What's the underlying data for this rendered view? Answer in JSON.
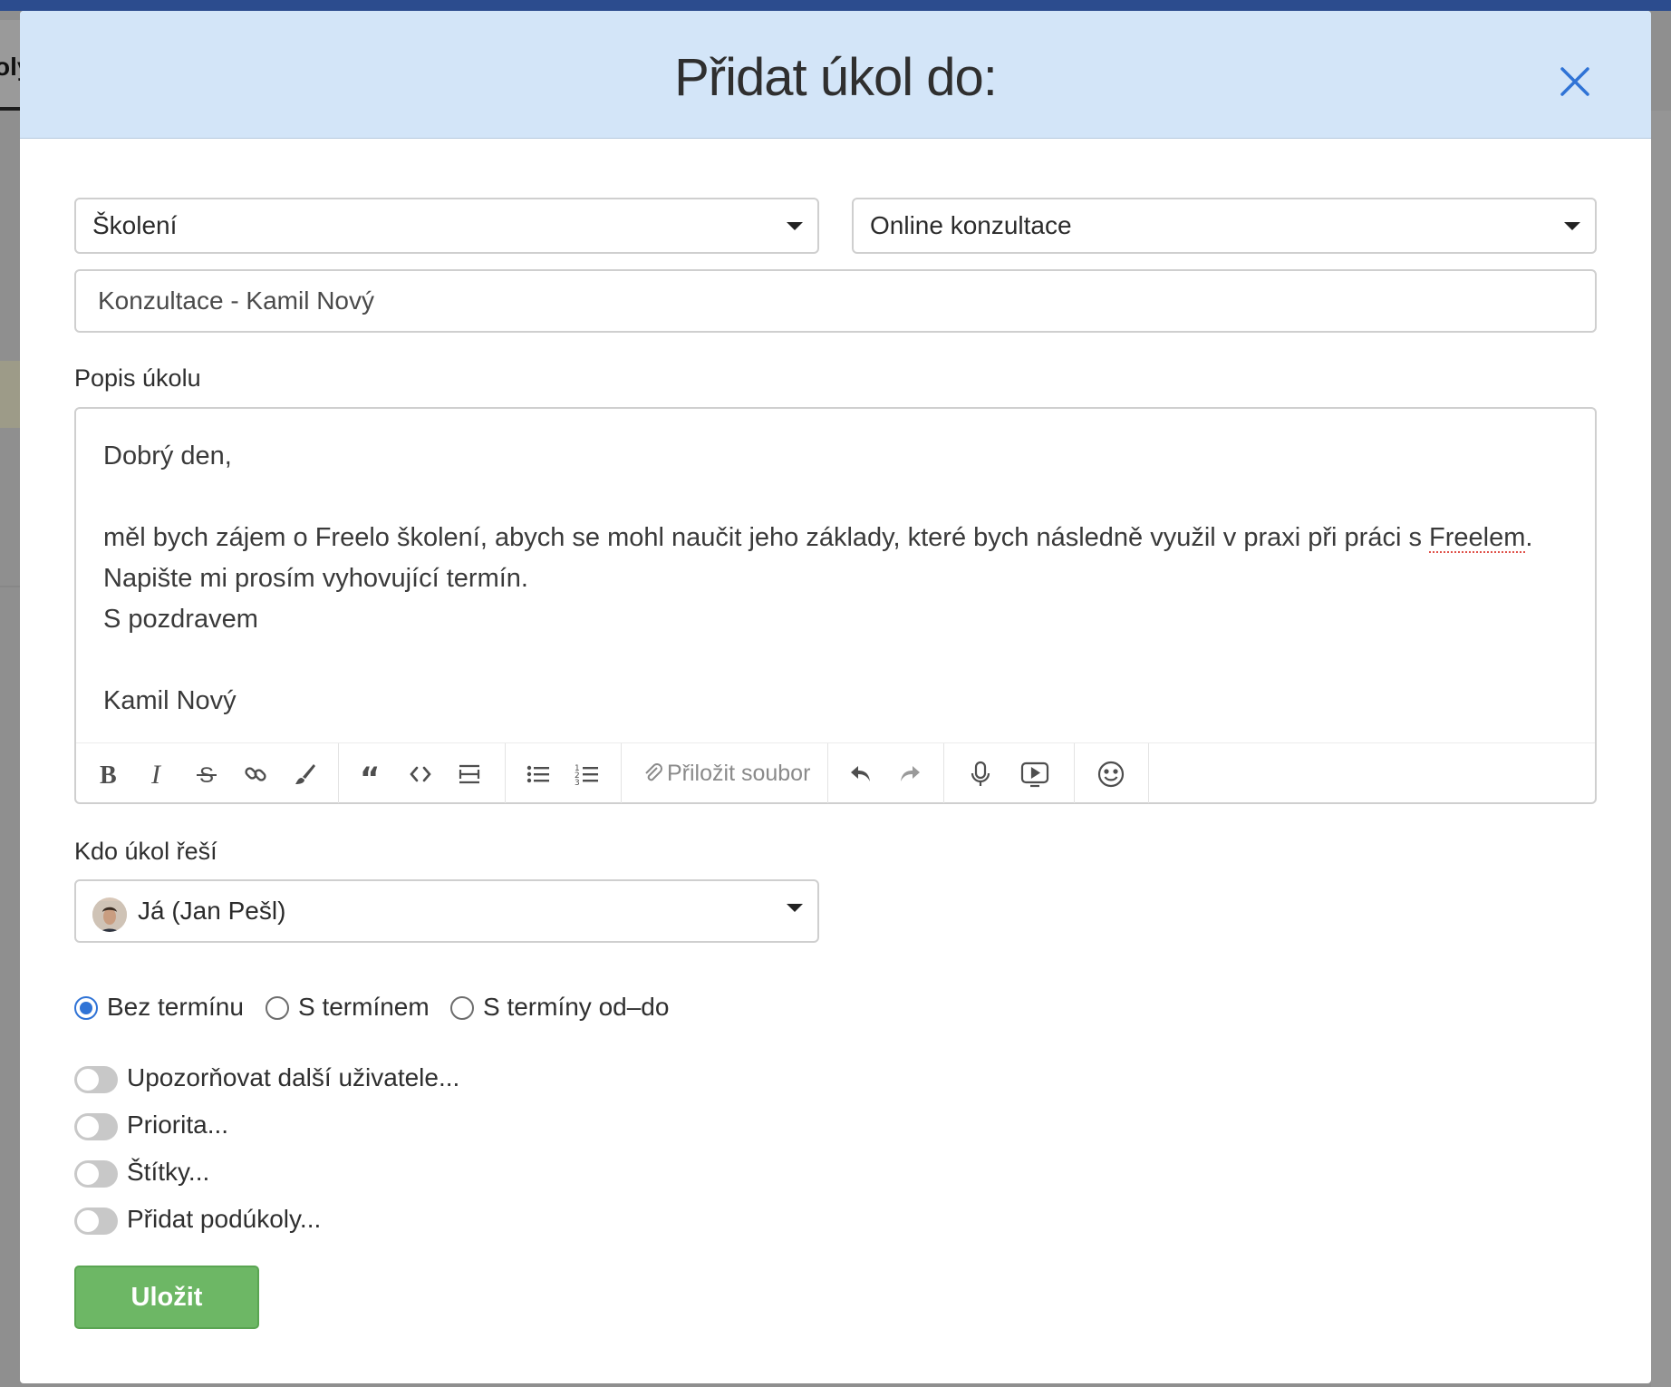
{
  "background": {
    "tab_fragment": "oly"
  },
  "modal": {
    "title": "Přidat úkol do:",
    "project_select": "Školení",
    "list_select": "Online konzultace",
    "task_name": "Konzultace - Kamil Nový",
    "description_label": "Popis úkolu",
    "description": {
      "line1": "Dobrý den,",
      "line2_before": "měl bych zájem o Freelo školení, abych se mohl naučit jeho základy, které bych následně využil v praxi při práci s ",
      "line2_misspelled": "Freelem",
      "line2_after": ". Napište mi prosím vyhovující termín.",
      "line3": "S pozdravem",
      "line4": "Kamil Nový"
    },
    "toolbar": {
      "attach_label": "Přiložit soubor"
    },
    "assignee_label": "Kdo úkol řeší",
    "assignee_value": "Já (Jan Pešl)",
    "deadline_options": [
      "Bez termínu",
      "S termínem",
      "S termíny od–do"
    ],
    "deadline_selected": "Bez termínu",
    "toggles": [
      "Upozorňovat další uživatele...",
      "Priorita...",
      "Štítky...",
      "Přidat podúkoly..."
    ],
    "save_label": "Uložit"
  },
  "colors": {
    "header_bg": "#d3e5f8",
    "accent": "#2f73d6",
    "save_button": "#6db765",
    "app_topbar": "#2c4c8e"
  }
}
